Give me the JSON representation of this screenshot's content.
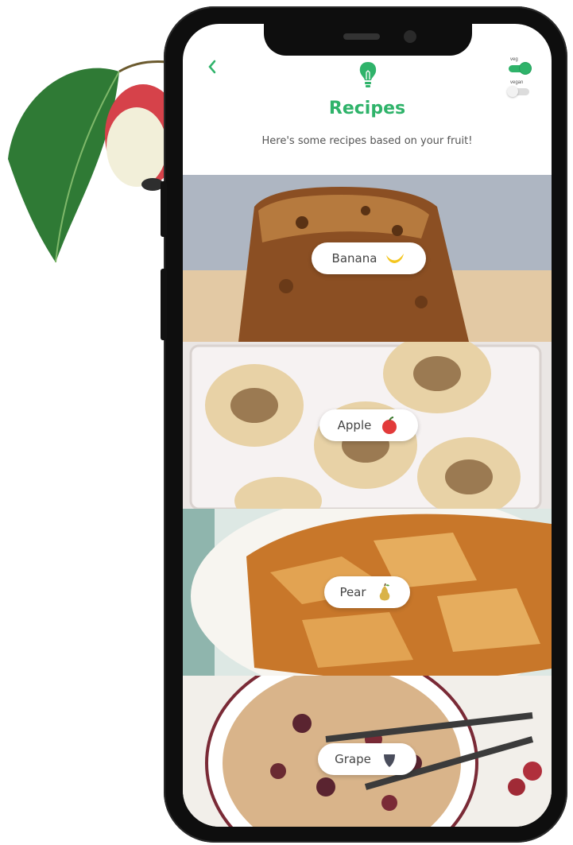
{
  "header": {
    "back_icon": "chevron-left-icon",
    "logo_icon": "lightbulb-icon",
    "title": "Recipes",
    "subtitle": "Here's some recipes based on your fruit!",
    "toggles": [
      {
        "label": "veg",
        "on": true
      },
      {
        "label": "vegan",
        "on": false
      }
    ]
  },
  "recipes": [
    {
      "label": "Banana",
      "icon": "banana-icon"
    },
    {
      "label": "Apple",
      "icon": "apple-icon"
    },
    {
      "label": "Pear",
      "icon": "pear-icon"
    },
    {
      "label": "Grape",
      "icon": "grape-icon"
    }
  ],
  "colors": {
    "accent": "#2fb36a",
    "phone_frame": "#0e0e0e",
    "text": "#555555"
  }
}
